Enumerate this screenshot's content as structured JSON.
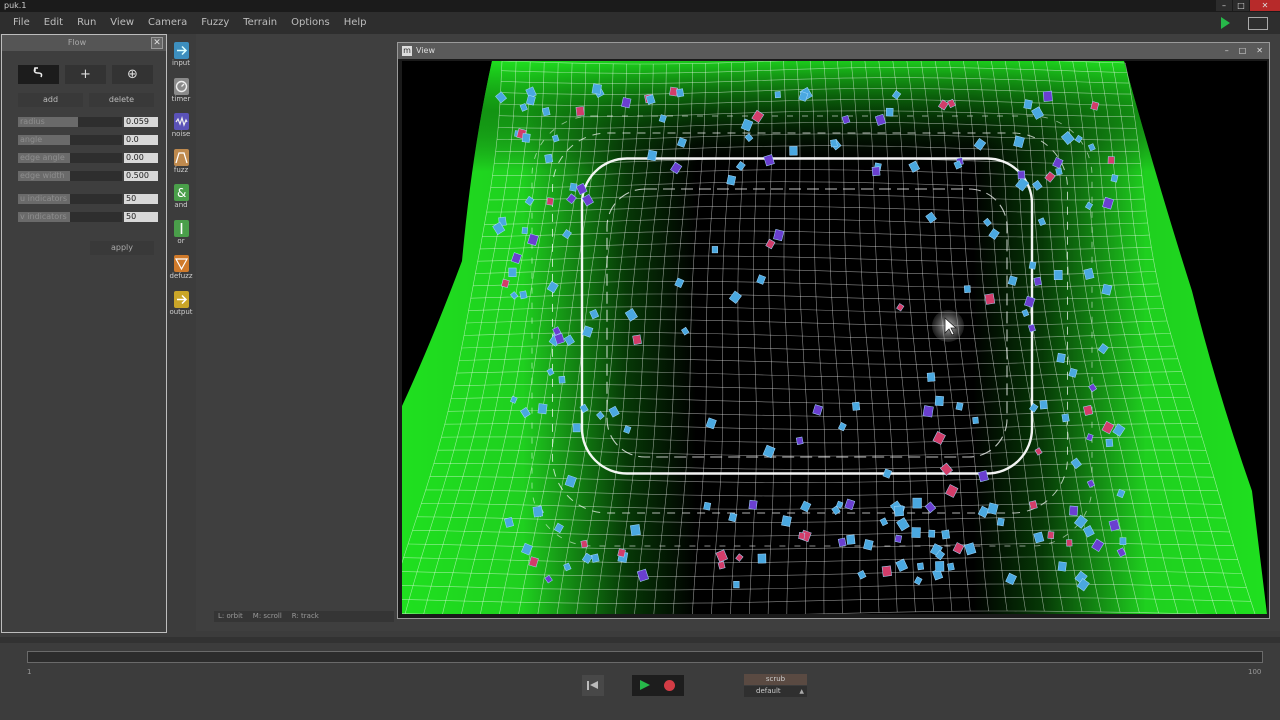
{
  "window": {
    "title": "puk.1"
  },
  "menu": [
    "File",
    "Edit",
    "Run",
    "View",
    "Camera",
    "Fuzzy",
    "Terrain",
    "Options",
    "Help"
  ],
  "flow_panel": {
    "title": "Flow",
    "add_label": "add",
    "delete_label": "delete",
    "params": [
      {
        "label": "radius",
        "value": "0.059",
        "level": 0.58
      },
      {
        "label": "angle",
        "value": "0.0",
        "level": 0.5
      },
      {
        "label": "edge angle",
        "value": "0.00",
        "level": 0.5
      },
      {
        "label": "edge width",
        "value": "0.500",
        "level": 0.5
      }
    ],
    "indicators": [
      {
        "label": "u indicators",
        "value": "50",
        "level": 0.5
      },
      {
        "label": "v indicators",
        "value": "50",
        "level": 0.5
      }
    ],
    "apply_label": "apply"
  },
  "toolbar": [
    {
      "label": "input",
      "color": "#3d8fbf"
    },
    {
      "label": "timer",
      "color": "#8a8a8a"
    },
    {
      "label": "noise",
      "color": "#5a52b8"
    },
    {
      "label": "fuzz",
      "color": "#bf8a4e"
    },
    {
      "label": "and",
      "color": "#4a9f4a"
    },
    {
      "label": "or",
      "color": "#4a9f4a"
    },
    {
      "label": "defuzz",
      "color": "#d07a2a"
    },
    {
      "label": "output",
      "color": "#c9a528"
    }
  ],
  "view": {
    "title": "View"
  },
  "nav_hints": [
    "L: orbit",
    "M: scroll",
    "R: track"
  ],
  "timeline": {
    "start": "1",
    "end": "100"
  },
  "controls": {
    "scrub_label": "scrub",
    "preset_label": "default"
  },
  "colors": {
    "terrain": "#22e622",
    "mesh": "#ffffff",
    "agent_cyan": "#4aa8e0",
    "agent_pink": "#d23d6a",
    "agent_purple": "#6a3fd0"
  }
}
